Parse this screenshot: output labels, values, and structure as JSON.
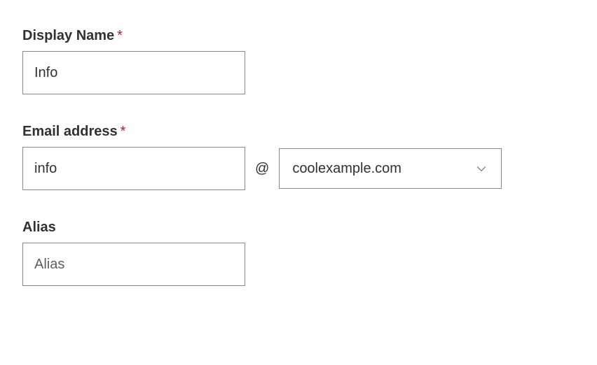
{
  "fields": {
    "displayName": {
      "label": "Display Name",
      "required": true,
      "value": "Info",
      "placeholder": ""
    },
    "emailAddress": {
      "label": "Email address",
      "required": true,
      "localPart": {
        "value": "info",
        "placeholder": ""
      },
      "atSymbol": "@",
      "domain": {
        "selected": "coolexample.com"
      }
    },
    "alias": {
      "label": "Alias",
      "required": false,
      "value": "",
      "placeholder": "Alias"
    }
  },
  "requiredMarker": "*"
}
